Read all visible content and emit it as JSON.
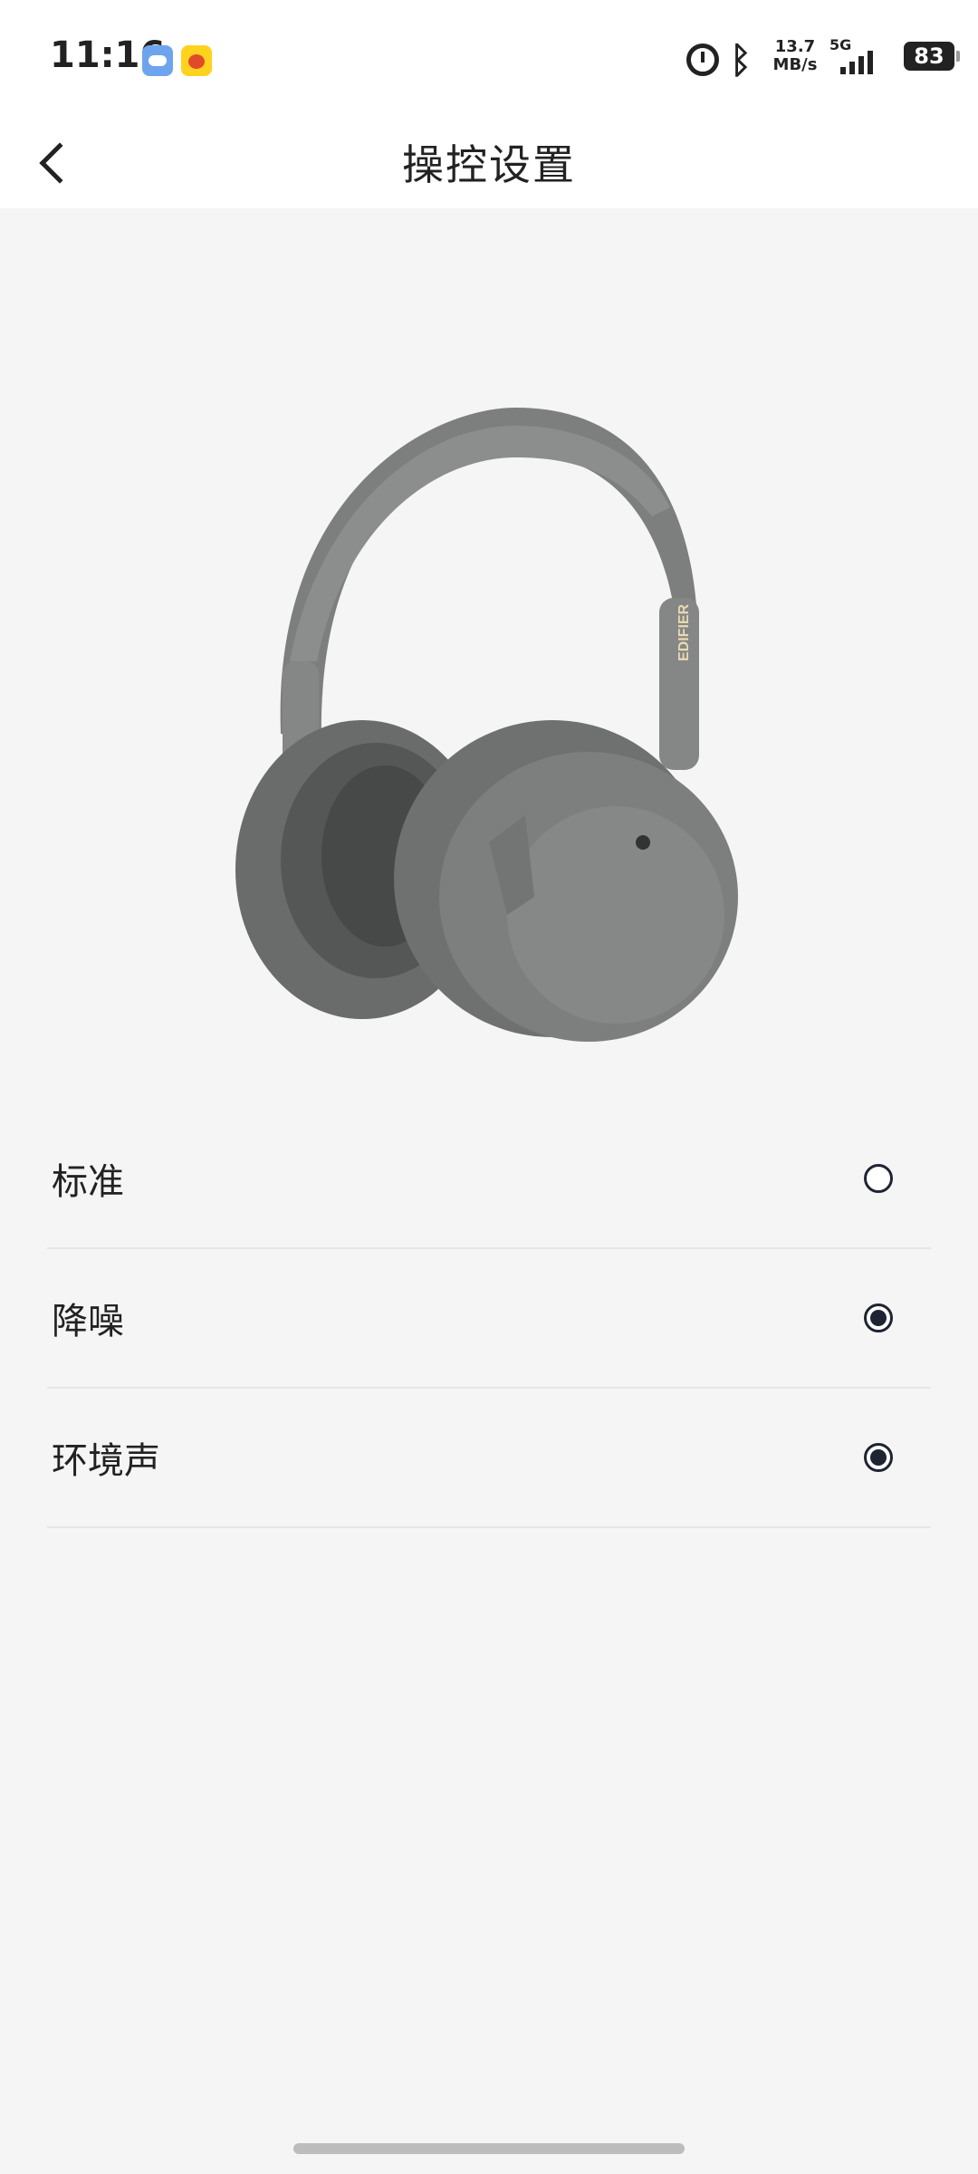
{
  "status_bar": {
    "time": "11:16",
    "net_speed_value": "13.7",
    "net_speed_unit": "MB/s",
    "network": "5G",
    "battery": "83",
    "icons": [
      "weather-icon",
      "kid-app-icon",
      "alarm-icon",
      "bluetooth-icon",
      "signal-icon",
      "battery-icon"
    ]
  },
  "nav": {
    "title": "操控设置"
  },
  "hero": {
    "product_brand": "EDIFIER"
  },
  "options": [
    {
      "label": "标准",
      "checked": false
    },
    {
      "label": "降噪",
      "checked": true
    },
    {
      "label": "环境声",
      "checked": true
    }
  ],
  "colors": {
    "background": "#f5f5f5",
    "radio_accent": "#1f2433",
    "headphone": "#6f7171"
  }
}
